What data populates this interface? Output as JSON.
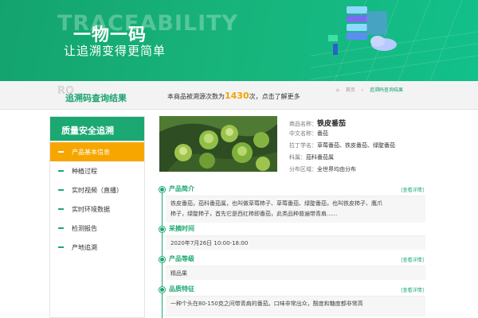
{
  "banner": {
    "bg_word": "TRACEABILITY",
    "headline": "一物一码",
    "subline": "让追溯变得更简单"
  },
  "crumbbar": {
    "watermark": "RO",
    "page_heading": "追溯码查询结果",
    "count_prefix": "本商品被溯源次数为",
    "count_value": "1430",
    "count_suffix": "次，点击了解更多",
    "breadcrumb": [
      "首页",
      "追溯码查询结果"
    ]
  },
  "sidebar": {
    "title": "质量安全追溯",
    "items": [
      {
        "label": "产品基本信息",
        "active": true
      },
      {
        "label": "种植过程"
      },
      {
        "label": "实时视频（直播）"
      },
      {
        "label": "实时环境数据"
      },
      {
        "label": "检测报告"
      },
      {
        "label": "产地追溯"
      }
    ]
  },
  "product": {
    "rows": [
      {
        "k": "商品名称：",
        "v": "铁皮番茄"
      },
      {
        "k": "中文名称：",
        "v": "番茄"
      },
      {
        "k": "拉丁学名：",
        "v": "草莓番茄、铁皮番茄、绿腚番茄"
      },
      {
        "k": "科属：",
        "v": "茄科番茄属"
      },
      {
        "k": "分布区域：",
        "v": "全世界均由分布"
      }
    ]
  },
  "sections": [
    {
      "title": "产品简介",
      "more": "[查看详情]",
      "body": [
        "铁皮番茄，茄科番茄属，也叫做草莓柿子、草莓番茄、绿腚番茄，也叫铁皮柿子、鹰爪",
        "柿子，绿腚柿子，首先它是西红柿即番茄，此类品种普遍带青肩......"
      ]
    },
    {
      "title": "采摘时间",
      "body": [
        "2020年7月26日    10:00-18:00"
      ]
    },
    {
      "title": "产品等级",
      "more": "[查看详情]",
      "body": [
        "精品果"
      ]
    },
    {
      "title": "品质特征",
      "more": "[查看详情]",
      "body": [
        "一种个头在80-150克之间带青肩的番茄。口味非常出众，酸度和糖度都非常高"
      ]
    }
  ],
  "colors": {
    "brand_green": "#1ba873",
    "accent_orange": "#f7a600",
    "count_highlight": "#f0a500"
  },
  "icons": [
    "server-stack-icon",
    "cloud-icon",
    "home-icon"
  ]
}
